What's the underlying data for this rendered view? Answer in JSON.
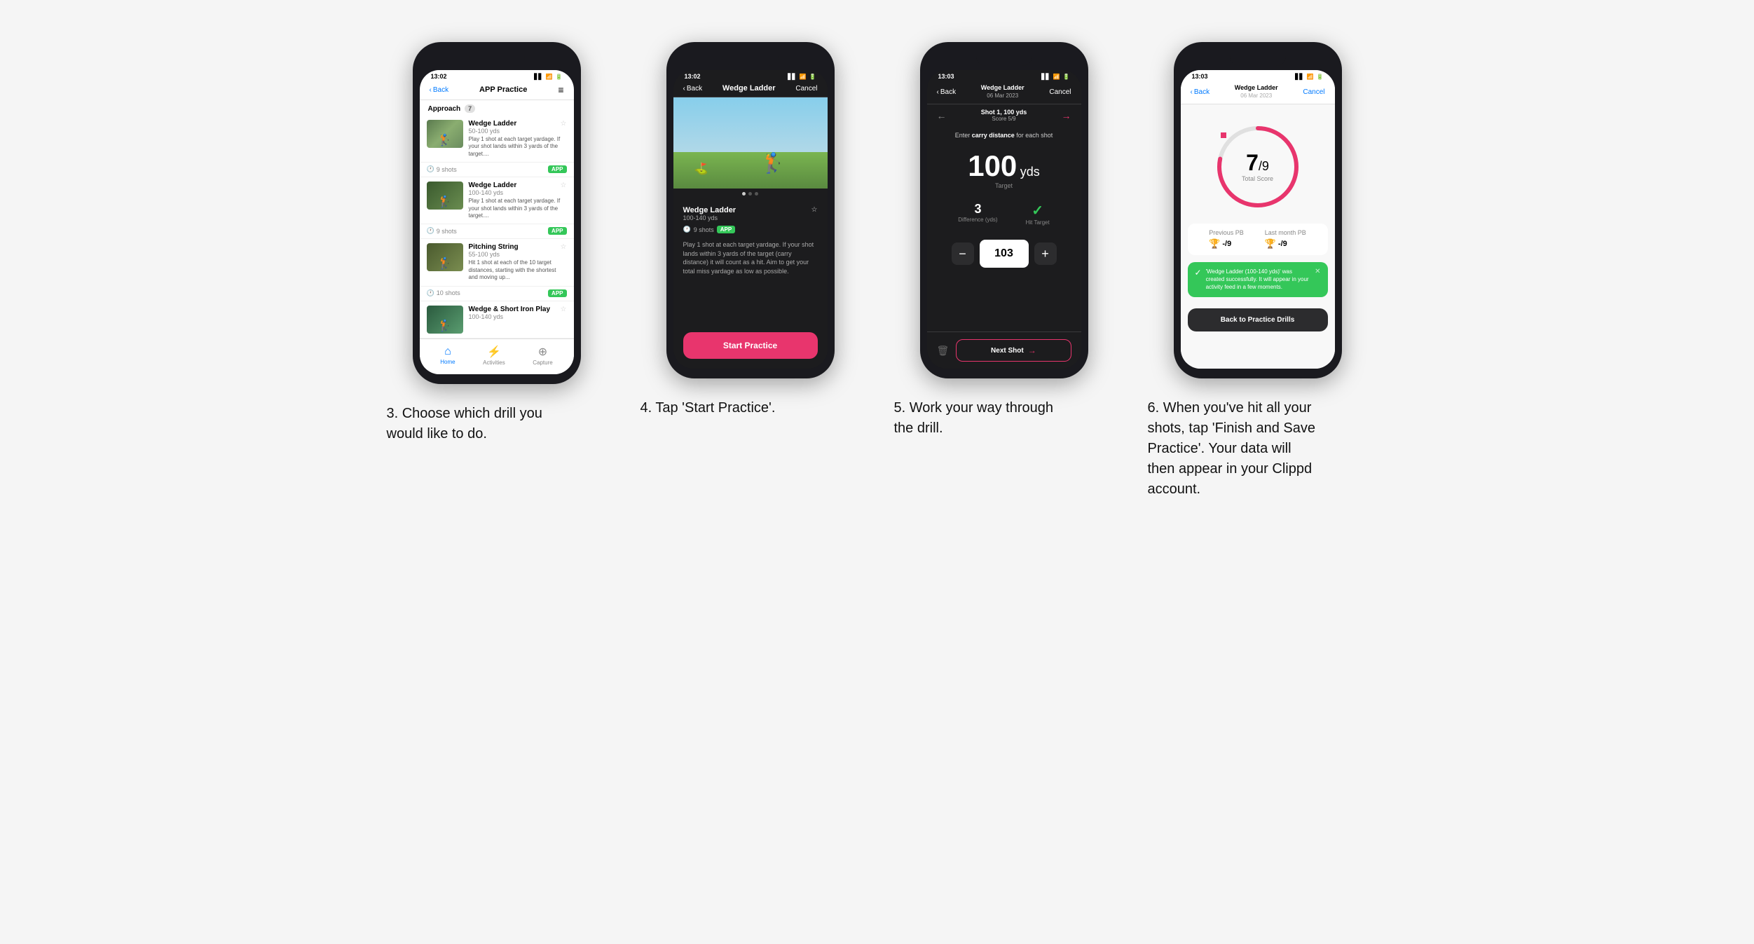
{
  "steps": [
    {
      "id": "step3",
      "description": "3. Choose which drill you would like to do.",
      "phone": {
        "statusBar": {
          "time": "13:02",
          "theme": "light"
        },
        "navBar": {
          "back": "Back",
          "title": "APP Practice",
          "action": "≡",
          "theme": "light"
        },
        "sectionHeader": "Approach",
        "sectionBadge": "7",
        "drills": [
          {
            "name": "Wedge Ladder",
            "range": "50-100 yds",
            "desc": "Play 1 shot at each target yardage. If your shot lands within 3 yards of the target....",
            "shots": "9 shots",
            "badge": "APP"
          },
          {
            "name": "Wedge Ladder",
            "range": "100-140 yds",
            "desc": "Play 1 shot at each target yardage. If your shot lands within 3 yards of the target....",
            "shots": "9 shots",
            "badge": "APP"
          },
          {
            "name": "Pitching String",
            "range": "55-100 yds",
            "desc": "Hit 1 shot at each of the 10 target distances, starting with the shortest and moving up...",
            "shots": "10 shots",
            "badge": "APP"
          },
          {
            "name": "Wedge & Short Iron Play",
            "range": "100-140 yds",
            "desc": "",
            "shots": "",
            "badge": ""
          }
        ],
        "bottomNav": [
          {
            "label": "Home",
            "icon": "⌂",
            "active": true
          },
          {
            "label": "Activities",
            "icon": "⚡",
            "active": false
          },
          {
            "label": "Capture",
            "icon": "+",
            "active": false
          }
        ]
      }
    },
    {
      "id": "step4",
      "description": "4. Tap 'Start Practice'.",
      "phone": {
        "statusBar": {
          "time": "13:02",
          "theme": "dark"
        },
        "navBar": {
          "back": "Back",
          "title": "Wedge Ladder",
          "action": "Cancel",
          "theme": "dark"
        },
        "drillName": "Wedge Ladder",
        "drillRange": "100-140 yds",
        "drillShots": "9 shots",
        "drillBadge": "APP",
        "drillDesc": "Play 1 shot at each target yardage. If your shot lands within 3 yards of the target (carry distance) it will count as a hit. Aim to get your total miss yardage as low as possible.",
        "startBtnLabel": "Start Practice"
      }
    },
    {
      "id": "step5",
      "description": "5. Work your way through the drill.",
      "phone": {
        "statusBar": {
          "time": "13:03",
          "theme": "dark"
        },
        "navBarTitle1": "Wedge Ladder",
        "navBarTitle2": "06 Mar 2023",
        "navBack": "Back",
        "navAction": "Cancel",
        "shotLabel": "Shot 1, 100 yds",
        "scoreLabel": "Score 5/9",
        "instruction": "Enter carry distance for each shot",
        "targetYds": "100",
        "targetUnit": "yds",
        "targetLabel": "Target",
        "difference": "3",
        "differenceLabel": "Difference (yds)",
        "hitTarget": "●",
        "hitTargetLabel": "Hit Target",
        "inputValue": "103",
        "nextShotLabel": "Next Shot"
      }
    },
    {
      "id": "step6",
      "description": "6. When you've hit all your shots, tap 'Finish and Save Practice'. Your data will then appear in your Clippd account.",
      "phone": {
        "statusBar": {
          "time": "13:03",
          "theme": "light"
        },
        "navBarTitle1": "Wedge Ladder",
        "navBarTitle2": "06 Mar 2023",
        "navBack": "Back",
        "navAction": "Cancel",
        "scoreMain": "7",
        "scoreDenom": "/9",
        "scoreSubLabel": "Total Score",
        "prevPBLabel": "Previous PB",
        "prevPBValue": "-/9",
        "lastMonthPBLabel": "Last month PB",
        "lastMonthPBValue": "-/9",
        "toastText": "'Wedge Ladder (100-140 yds)' was created successfully. It will appear in your activity feed in a few moments.",
        "backLabel": "Back to Practice Drills",
        "scorePercent": 78
      }
    }
  ]
}
